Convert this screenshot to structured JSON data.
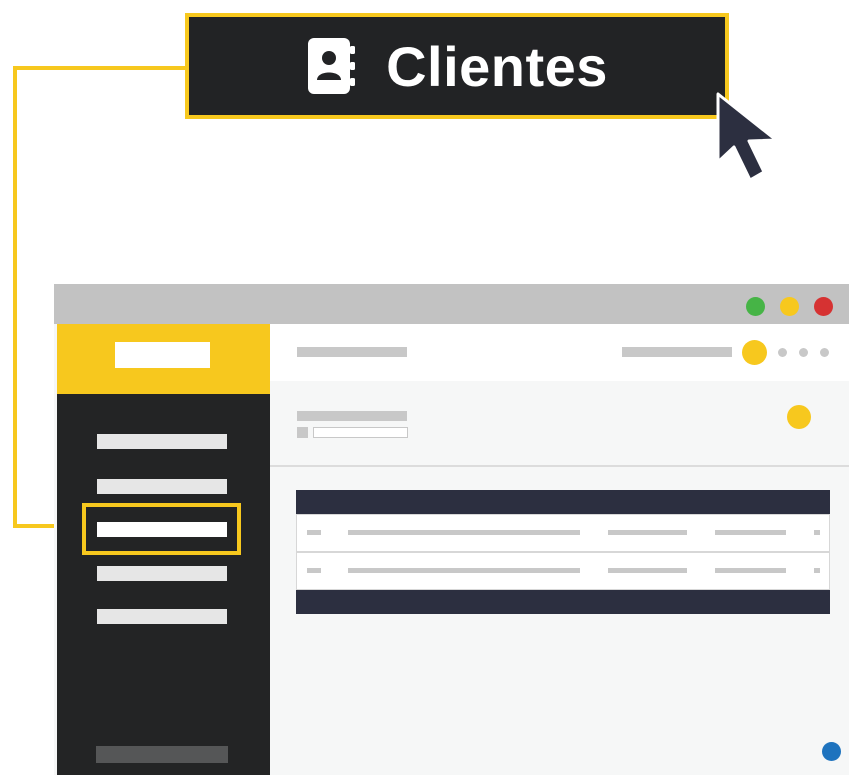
{
  "callout": {
    "label": "Clientes",
    "icon": "contacts-book-icon"
  },
  "colors": {
    "accent": "#f7c81e",
    "dark": "#222325",
    "table_header": "#2c2f40",
    "window_green": "#46b446",
    "window_yellow": "#f7c81e",
    "window_red": "#d63232",
    "notify_blue": "#1e73be"
  },
  "sidebar": {
    "items": [
      {
        "name": "sidebar-item-1"
      },
      {
        "name": "sidebar-item-2"
      },
      {
        "name": "sidebar-item-clientes",
        "highlighted": true
      },
      {
        "name": "sidebar-item-4"
      },
      {
        "name": "sidebar-item-5"
      }
    ]
  }
}
